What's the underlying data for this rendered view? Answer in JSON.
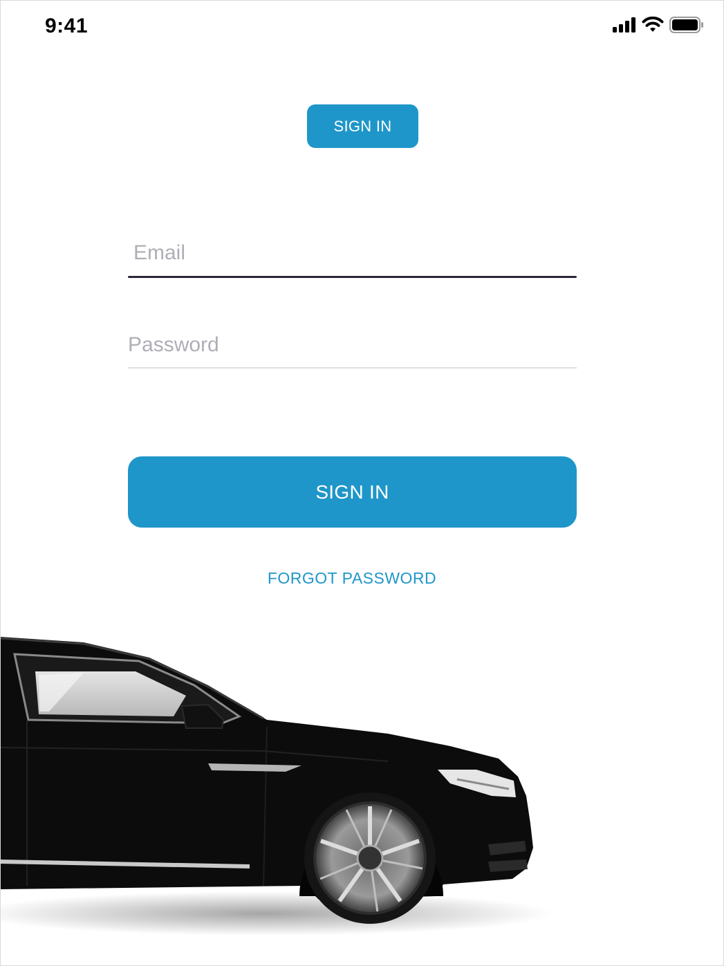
{
  "status_bar": {
    "time": "9:41"
  },
  "top_tab": {
    "label": "SIGN IN"
  },
  "form": {
    "email": {
      "value": "",
      "placeholder": "Email"
    },
    "password": {
      "value": "",
      "placeholder": "Password"
    },
    "submit_label": "SIGN IN",
    "forgot_label": "FORGOT PASSWORD"
  },
  "colors": {
    "accent": "#1f96c9",
    "focus_underline": "#2e2638",
    "placeholder": "#b0adb6",
    "car_body": "#0c0c0c"
  },
  "icons": [
    "cellular-signal-icon",
    "wifi-icon",
    "battery-icon"
  ],
  "image": {
    "subject": "black-sedan-car-image"
  }
}
